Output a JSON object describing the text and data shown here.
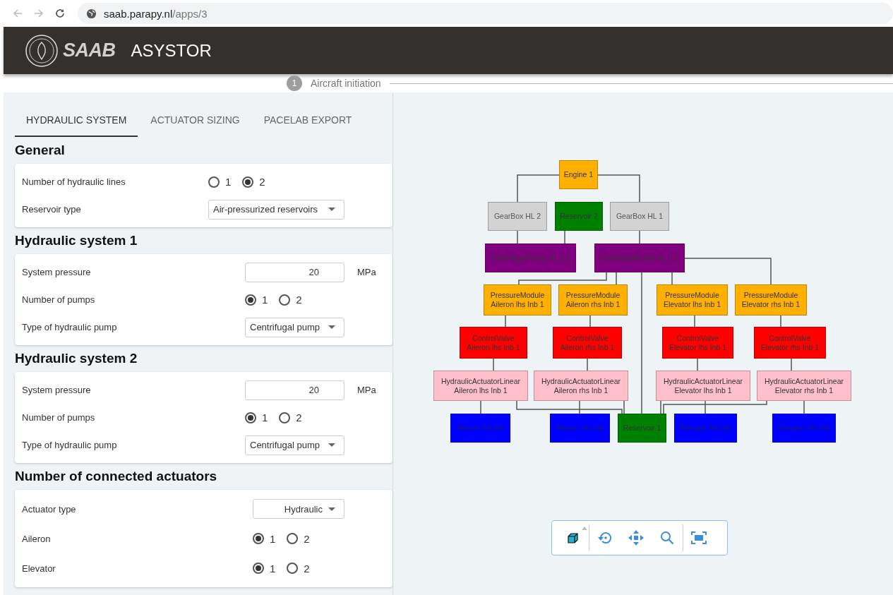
{
  "browser": {
    "url_host": "saab.parapy.nl",
    "url_path": "/apps/3"
  },
  "header": {
    "brand": "SAAB",
    "title": "ASYSTOR"
  },
  "stepper": [
    {
      "number": "1",
      "label": "Aircraft initiation"
    }
  ],
  "tabs": [
    {
      "label": "HYDRAULIC SYSTEM",
      "selected": true
    },
    {
      "label": "ACTUATOR SIZING",
      "selected": false
    },
    {
      "label": "PACELAB EXPORT",
      "selected": false
    }
  ],
  "sections": [
    {
      "title": "General",
      "fields": [
        {
          "kind": "radio",
          "label": "Number of hydraulic lines",
          "options": [
            {
              "label": "1",
              "selected": false
            },
            {
              "label": "2",
              "selected": true
            }
          ]
        },
        {
          "kind": "select",
          "label": "Reservoir type",
          "value": "Air-pressurized reservoirs"
        }
      ]
    },
    {
      "title": "Hydraulic system 1",
      "fields": [
        {
          "kind": "number",
          "label": "System pressure",
          "value": "20",
          "unit": "MPa"
        },
        {
          "kind": "radio",
          "label": "Number of pumps",
          "options": [
            {
              "label": "1",
              "selected": true
            },
            {
              "label": "2",
              "selected": false
            }
          ]
        },
        {
          "kind": "select",
          "label": "Type of hydraulic pump",
          "value": "Centrifugal pump"
        }
      ]
    },
    {
      "title": "Hydraulic system 2",
      "fields": [
        {
          "kind": "number",
          "label": "System pressure",
          "value": "20",
          "unit": "MPa"
        },
        {
          "kind": "radio",
          "label": "Number of pumps",
          "options": [
            {
              "label": "1",
              "selected": true
            },
            {
              "label": "2",
              "selected": false
            }
          ]
        },
        {
          "kind": "select",
          "label": "Type of hydraulic pump",
          "value": "Centrifugal pump"
        }
      ]
    },
    {
      "title": "Number of connected actuators",
      "fields": [
        {
          "kind": "select",
          "label": "Actuator type",
          "value": "Hydraulic"
        },
        {
          "kind": "radio",
          "label": "Aileron",
          "options": [
            {
              "label": "1",
              "selected": true
            },
            {
              "label": "2",
              "selected": false
            }
          ]
        },
        {
          "kind": "radio",
          "label": "Elevator",
          "options": [
            {
              "label": "1",
              "selected": true
            },
            {
              "label": "2",
              "selected": false
            }
          ]
        }
      ]
    }
  ],
  "diagram": {
    "nodes": [
      {
        "lines": [
          "Engine 1"
        ],
        "color": "#ffb000"
      },
      {
        "lines": [
          "GearBox HL 2"
        ],
        "color": "#d3d3d3"
      },
      {
        "lines": [
          "Reservoir 2"
        ],
        "color": "#008000"
      },
      {
        "lines": [
          "GearBox HL 1"
        ],
        "color": "#d3d3d3"
      },
      {
        "lines": [
          "CentrifugalPump HL 2 1"
        ],
        "color": "#800080"
      },
      {
        "lines": [
          "CentrifugalPump HL 1 1"
        ],
        "color": "#800080"
      },
      {
        "lines": [
          "PressureModule",
          "Aileron lhs Inb 1"
        ],
        "color": "#ffb000"
      },
      {
        "lines": [
          "PressureModule",
          "Aileron rhs Inb 1"
        ],
        "color": "#ffb000"
      },
      {
        "lines": [
          "PressureModule",
          "Elevator lhs Inb 1"
        ],
        "color": "#ffb000"
      },
      {
        "lines": [
          "PressureModule",
          "Elevator rhs Inb 1"
        ],
        "color": "#ffb000"
      },
      {
        "lines": [
          "ControlValve",
          "Aileron lhs Inb 1"
        ],
        "color": "#ff0000"
      },
      {
        "lines": [
          "ControlValve",
          "Aileron rhs Inb 1"
        ],
        "color": "#ff0000"
      },
      {
        "lines": [
          "ControlValve",
          "Elevator lhs Inb 1"
        ],
        "color": "#ff0000"
      },
      {
        "lines": [
          "ControlValve",
          "Elevator rhs Inb 1"
        ],
        "color": "#ff0000"
      },
      {
        "lines": [
          "HydraulicActuatorLinear",
          "Aileron lhs Inb 1"
        ],
        "color": "#ffc0cb"
      },
      {
        "lines": [
          "HydraulicActuatorLinear",
          "Aileron rhs Inb 1"
        ],
        "color": "#ffc0cb"
      },
      {
        "lines": [
          "HydraulicActuatorLinear",
          "Elevator lhs Inb 1"
        ],
        "color": "#ffc0cb"
      },
      {
        "lines": [
          "HydraulicActuatorLinear",
          "Elevator rhs Inb 1"
        ],
        "color": "#ffc0cb"
      },
      {
        "lines": [
          "Aileron lhs Inb"
        ],
        "color": "#0000ff"
      },
      {
        "lines": [
          "Aileron rhs Inb"
        ],
        "color": "#0000ff"
      },
      {
        "lines": [
          "Reservoir 1"
        ],
        "color": "#008000"
      },
      {
        "lines": [
          "Elevator lhs Inb"
        ],
        "color": "#0000ff"
      },
      {
        "lines": [
          "Elevator rhs Inb"
        ],
        "color": "#0000ff"
      }
    ]
  }
}
